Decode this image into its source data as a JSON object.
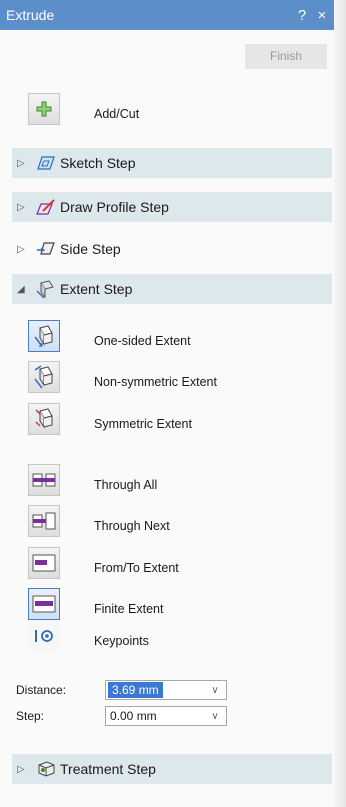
{
  "window": {
    "title": "Extrude",
    "help_glyph": "?",
    "close_glyph": "×"
  },
  "toolbar": {
    "finish_label": "Finish"
  },
  "add_cut": {
    "label": "Add/Cut",
    "icon": "plus-icon"
  },
  "steps": {
    "sketch": {
      "label": "Sketch Step",
      "icon": "sketch-step-icon",
      "state": "collapsed"
    },
    "draw_profile": {
      "label": "Draw Profile Step",
      "icon": "draw-profile-icon",
      "state": "collapsed"
    },
    "side": {
      "label": "Side Step",
      "icon": "side-step-icon",
      "state": "collapsed"
    },
    "extent": {
      "label": "Extent Step",
      "icon": "extent-step-icon",
      "state": "expanded"
    },
    "treatment": {
      "label": "Treatment Step",
      "icon": "treatment-step-icon",
      "state": "collapsed"
    }
  },
  "extent_side_options": [
    {
      "label": "One-sided Extent",
      "icon": "one-sided-extent-icon",
      "selected": true
    },
    {
      "label": "Non-symmetric Extent",
      "icon": "non-symmetric-extent-icon",
      "selected": false
    },
    {
      "label": "Symmetric Extent",
      "icon": "symmetric-extent-icon",
      "selected": false
    }
  ],
  "extent_type_options": [
    {
      "label": "Through All",
      "icon": "through-all-icon",
      "selected": false
    },
    {
      "label": "Through Next",
      "icon": "through-next-icon",
      "selected": false
    },
    {
      "label": "From/To Extent",
      "icon": "from-to-extent-icon",
      "selected": false
    },
    {
      "label": "Finite Extent",
      "icon": "finite-extent-icon",
      "selected": true
    }
  ],
  "keypoints": {
    "label": "Keypoints",
    "icon": "keypoints-icon"
  },
  "fields": {
    "distance": {
      "label": "Distance:",
      "value": "3.69 mm"
    },
    "step": {
      "label": "Step:",
      "value": "0.00 mm"
    }
  },
  "colors": {
    "titlebar": "#5c8fc9",
    "section_band": "#dde8ed",
    "accent_purple": "#7b2f9c",
    "selection_blue": "#3a78d4"
  }
}
